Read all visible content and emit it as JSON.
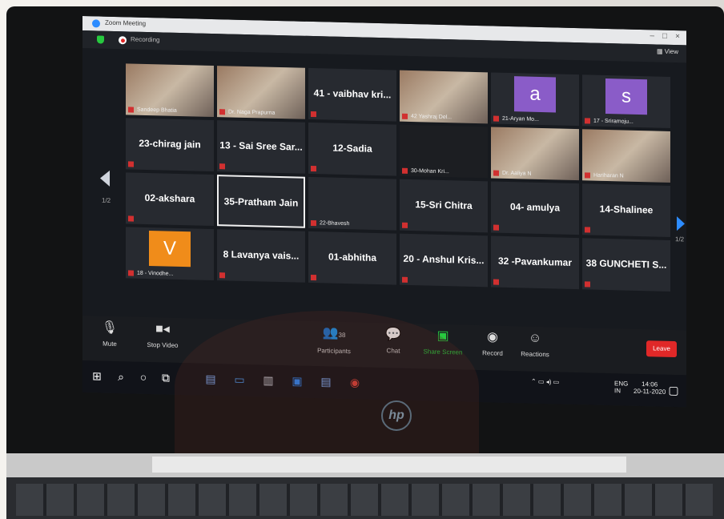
{
  "window": {
    "title": "Zoom Meeting",
    "recording_label": "Recording",
    "view_label": "View"
  },
  "pages": {
    "left": "1/2",
    "right": "1/2"
  },
  "tiles": [
    {
      "label": "Sandeep Bhatia"
    },
    {
      "label": "Dr. Naga Prapurna"
    },
    {
      "label": "41 - vaibhav kri..."
    },
    {
      "label": "42 Yashraj Del..."
    },
    {
      "label": "21-Aryan Mo...",
      "avatar": "a"
    },
    {
      "label": "17 - Sriramoju...",
      "avatar": "s"
    },
    {
      "label": "23-chirag jain"
    },
    {
      "label": "13 - Sai Sree Sar..."
    },
    {
      "label": "12-Sadia"
    },
    {
      "label": "30-Mohan Kri..."
    },
    {
      "label": "Dr. Aaliya N"
    },
    {
      "label": "Hariharan N"
    },
    {
      "label": "02-akshara"
    },
    {
      "label": "35-Pratham Jain"
    },
    {
      "label": "22-Bhavesh"
    },
    {
      "label": "15-Sri Chitra"
    },
    {
      "label": "04- amulya"
    },
    {
      "label": "14-Shalinee"
    },
    {
      "label": "18 - Vinodhe...",
      "avatar": "V"
    },
    {
      "label": "8   Lavanya vais..."
    },
    {
      "label": "01-abhitha"
    },
    {
      "label": "20 - Anshul Kris..."
    },
    {
      "label": "32 -Pavankumar"
    },
    {
      "label": "38 GUNCHETI S..."
    }
  ],
  "toolbar": {
    "mute": "Mute",
    "stop_video": "Stop Video",
    "participants": "Participants",
    "participants_count": "38",
    "chat": "Chat",
    "share_screen": "Share Screen",
    "record": "Record",
    "reactions": "Reactions",
    "leave": "Leave"
  },
  "taskbar": {
    "lang": "ENG",
    "region": "IN",
    "time": "14:06",
    "date": "20-11-2020"
  },
  "colors": {
    "zoom_blue": "#2d8cff",
    "leave_red": "#e02828",
    "share_green": "#27c93f",
    "avatar_purple": "#8a5cc8",
    "avatar_orange": "#f08c1a"
  }
}
